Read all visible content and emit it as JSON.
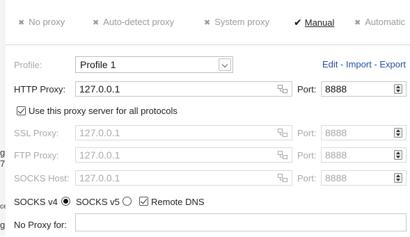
{
  "modes": {
    "no_proxy": "No proxy",
    "auto_detect": "Auto-detect proxy",
    "system": "System proxy",
    "manual": "Manual",
    "automatic": "Automatic"
  },
  "profile": {
    "label": "Profile:",
    "value": "Profile 1",
    "links": {
      "edit": "Edit",
      "sep": " - ",
      "import": "Import",
      "export": "Export"
    }
  },
  "http": {
    "label": "HTTP Proxy:",
    "host": "127.0.0.1",
    "port_label": "Port:",
    "port": "8888"
  },
  "use_all": {
    "label": "Use this proxy server for all protocols",
    "checked": true
  },
  "ssl": {
    "label": "SSL Proxy:",
    "host": "127.0.0.1",
    "port_label": "Port:",
    "port": "8888"
  },
  "ftp": {
    "label": "FTP Proxy:",
    "host": "127.0.0.1",
    "port_label": "Port:",
    "port": "8888"
  },
  "socks": {
    "label": "SOCKS Host:",
    "host": "127.0.0.1",
    "port_label": "Port:",
    "port": "8888"
  },
  "socks_version": {
    "v4_label": "SOCKS v4",
    "v5_label": "SOCKS v5",
    "selected": "v4",
    "remote_dns_label": "Remote DNS",
    "remote_dns_checked": true
  },
  "no_proxy_for": {
    "label": "No Proxy for:",
    "value": ""
  },
  "edge_chars": [
    "g",
    "7",
    "ce",
    "g"
  ]
}
